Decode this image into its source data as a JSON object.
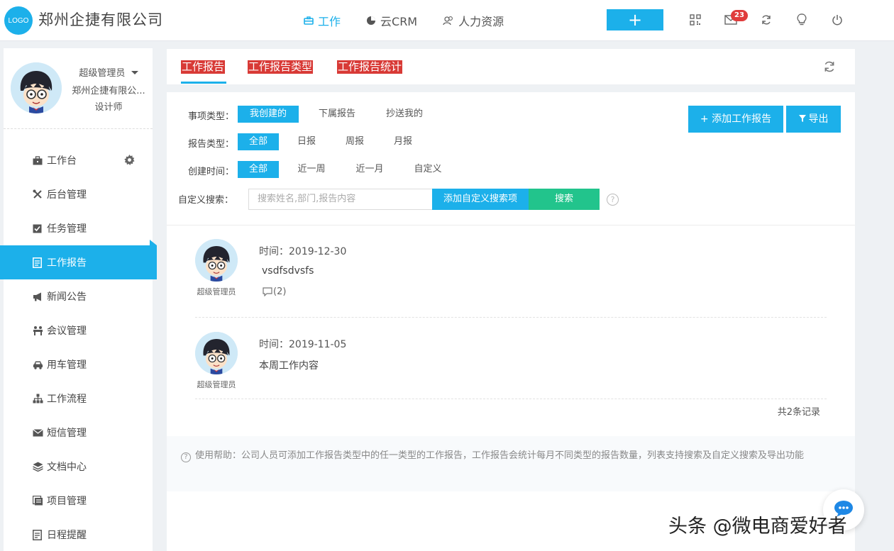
{
  "header": {
    "logo_text": "LOGO",
    "company": "郑州企捷有限公司",
    "nav": [
      {
        "label": "工作",
        "icon": "briefcase-icon",
        "active": true
      },
      {
        "label": "云CRM",
        "icon": "pie-chart-icon",
        "active": false
      },
      {
        "label": "人力资源",
        "icon": "users-icon",
        "active": false
      }
    ],
    "add_label": "+",
    "mail_count": "23"
  },
  "profile": {
    "role": "超级管理员",
    "company": "郑州企捷有限公...",
    "title": "设计师"
  },
  "sidebar": {
    "items": [
      {
        "label": "工作台",
        "icon": "briefcase-icon"
      },
      {
        "label": "后台管理",
        "icon": "tools-icon"
      },
      {
        "label": "任务管理",
        "icon": "checkbox-icon"
      },
      {
        "label": "工作报告",
        "icon": "report-icon",
        "active": true
      },
      {
        "label": "新闻公告",
        "icon": "megaphone-icon"
      },
      {
        "label": "会议管理",
        "icon": "meeting-icon"
      },
      {
        "label": "用车管理",
        "icon": "car-icon"
      },
      {
        "label": "工作流程",
        "icon": "flow-icon"
      },
      {
        "label": "短信管理",
        "icon": "envelope-icon"
      },
      {
        "label": "文档中心",
        "icon": "layers-icon"
      },
      {
        "label": "项目管理",
        "icon": "project-icon"
      },
      {
        "label": "日程提醒",
        "icon": "calendar-icon"
      }
    ]
  },
  "tabs": [
    {
      "label": "工作报告",
      "active": true
    },
    {
      "label": "工作报告类型"
    },
    {
      "label": "工作报告统计"
    }
  ],
  "filters": {
    "item_type": {
      "label": "事项类型：",
      "options": [
        "我创建的",
        "下属报告",
        "抄送我的"
      ],
      "selected": "我创建的"
    },
    "report_type": {
      "label": "报告类型：",
      "options": [
        "全部",
        "日报",
        "周报",
        "月报"
      ],
      "selected": "全部"
    },
    "created_time": {
      "label": "创建时间：",
      "options": [
        "全部",
        "近一周",
        "近一月",
        "自定义"
      ],
      "selected": "全部"
    },
    "custom_search": {
      "label": "自定义搜索：",
      "placeholder": "搜索姓名,部门,报告内容",
      "add_label": "添加自定义搜索项",
      "search_label": "搜索",
      "help_icon": "?"
    }
  },
  "actions": {
    "add_report": "+ 添加工作报告",
    "export": "导出"
  },
  "records": [
    {
      "author": "超级管理员",
      "time": "时间：2019-12-30",
      "content": "vsdfsdvsfs",
      "comments": "(2)"
    },
    {
      "author": "超级管理员",
      "time": "时间：2019-11-05",
      "content": "本周工作内容"
    }
  ],
  "total": "共2条记录",
  "help": {
    "icon": "?",
    "text": "使用帮助：公司人员可添加工作报告类型中的任一类型的工作报告，工作报告会统计每月不同类型的报告数量，列表支持搜索及自定义搜索及导出功能"
  },
  "watermark": "头条 @微电商爱好者",
  "colors": {
    "accent": "#1cb0ea",
    "tab_highlight": "#d83a36",
    "search_green": "#22c48c",
    "badge_red": "#e03c3c"
  }
}
